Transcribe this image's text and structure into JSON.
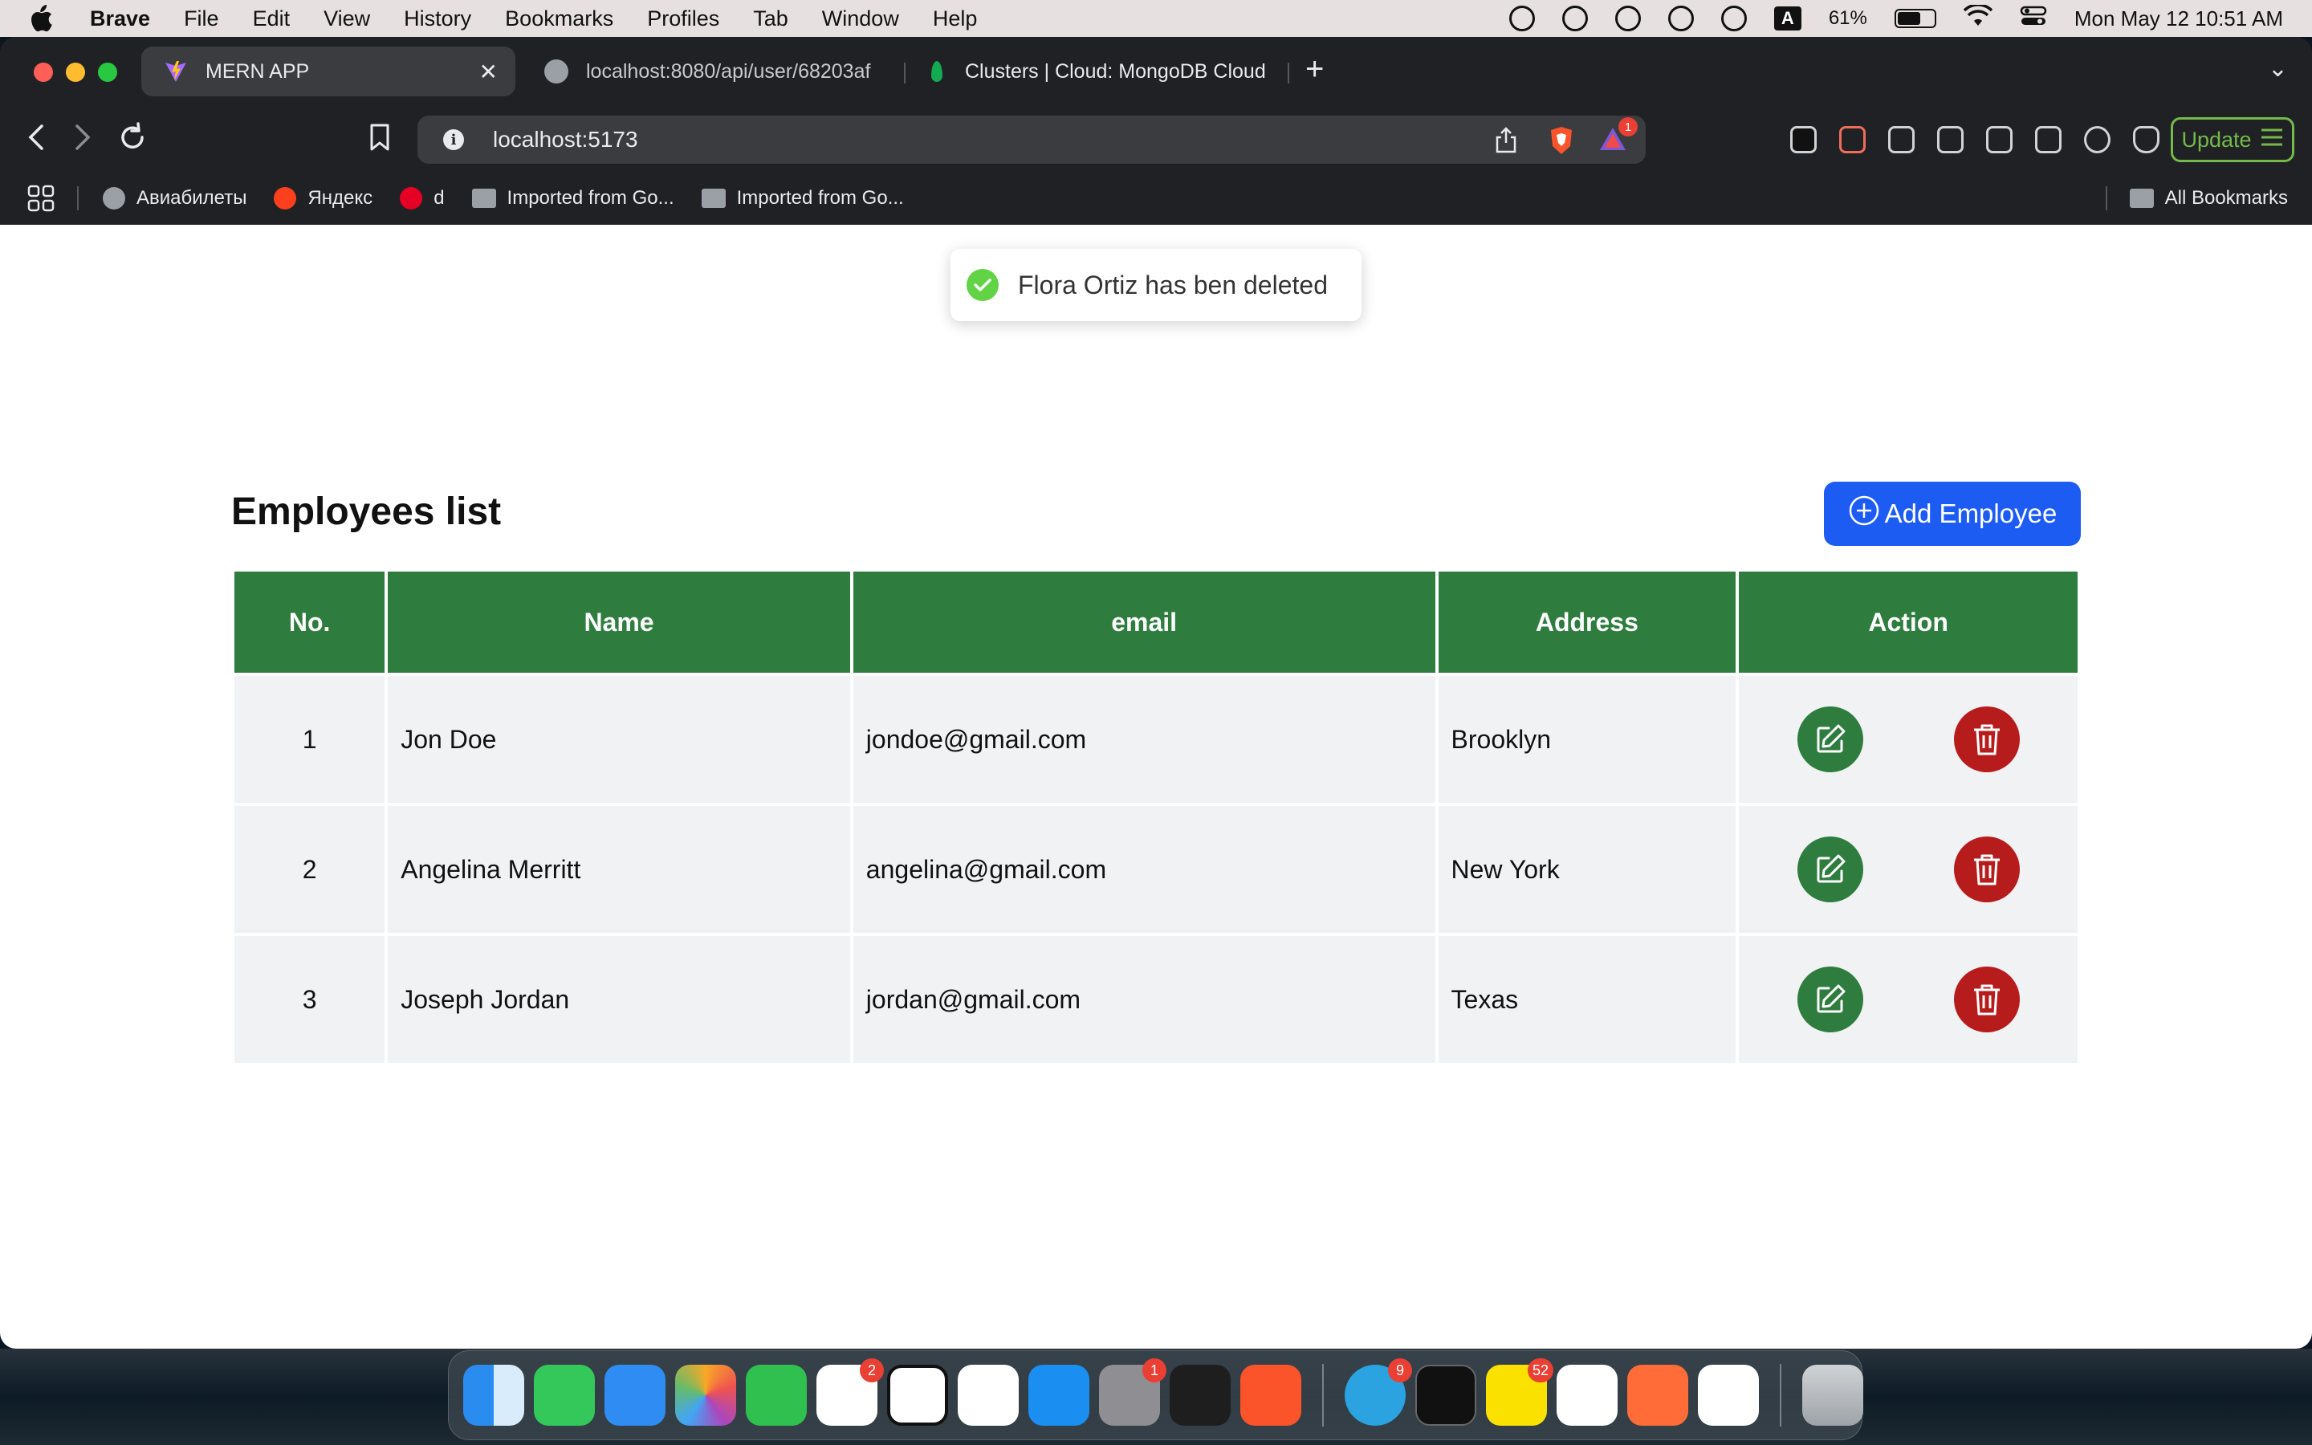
{
  "menubar": {
    "app_name": "Brave",
    "items": [
      "File",
      "Edit",
      "View",
      "History",
      "Bookmarks",
      "Profiles",
      "Tab",
      "Window",
      "Help"
    ],
    "input_source": "A",
    "battery": "61%",
    "datetime": "Mon May 12  10:51 AM"
  },
  "browser": {
    "tabs": [
      {
        "title": "MERN APP"
      },
      {
        "title": "localhost:8080/api/user/68203af"
      },
      {
        "title": "Clusters | Cloud: MongoDB Cloud"
      }
    ],
    "url": "localhost:5173",
    "brave_rewards_badge": "1",
    "update_label": "Update",
    "bookmarks": [
      {
        "label": "Авиабилеты"
      },
      {
        "label": "Яндекс"
      },
      {
        "label": "d"
      },
      {
        "label": "Imported from Go..."
      },
      {
        "label": "Imported from Go..."
      }
    ],
    "all_bookmarks": "All Bookmarks"
  },
  "page": {
    "toast": "Flora Ortiz has ben deleted",
    "title": "Employees list",
    "add_button": "Add Employee",
    "columns": [
      "No.",
      "Name",
      "email",
      "Address",
      "Action"
    ],
    "rows": [
      {
        "no": "1",
        "name": "Jon Doe",
        "email": "jondoe@gmail.com",
        "address": "Brooklyn"
      },
      {
        "no": "2",
        "name": "Angelina Merritt",
        "email": "angelina@gmail.com",
        "address": "New York"
      },
      {
        "no": "3",
        "name": "Joseph Jordan",
        "email": "jordan@gmail.com",
        "address": "Texas"
      }
    ]
  },
  "dock": {
    "badges": {
      "reminders": "2",
      "settings": "1",
      "telegram": "9",
      "kakaotalk": "52"
    }
  },
  "colors": {
    "header_green": "#2e7d3f",
    "edit_green": "#2e7d3f",
    "delete_red": "#b71c1c",
    "add_blue": "#1d5cf2",
    "toast_check": "#61d345"
  }
}
